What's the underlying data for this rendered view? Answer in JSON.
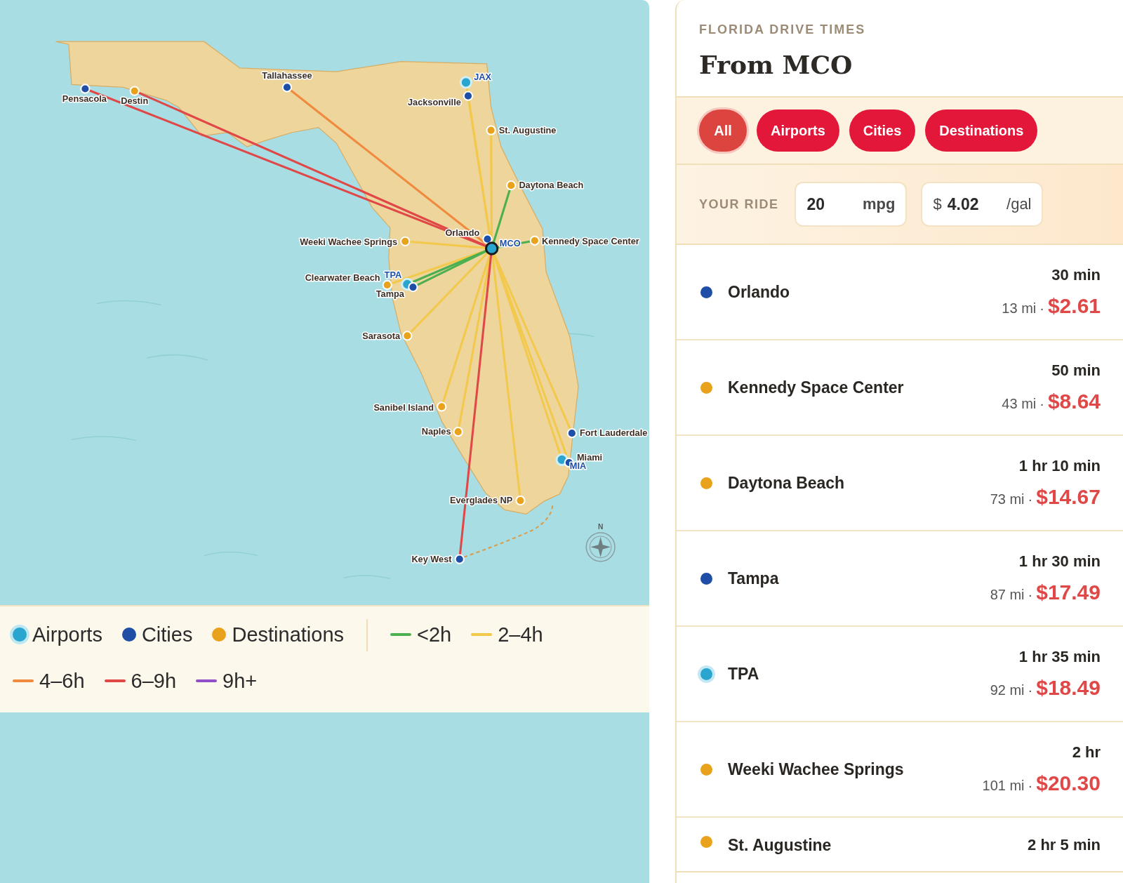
{
  "map": {
    "places": [
      {
        "label": "Pensacola",
        "kind": "city"
      },
      {
        "label": "Destin",
        "kind": "destination"
      },
      {
        "label": "Tallahassee",
        "kind": "city"
      },
      {
        "label": "JAX",
        "kind": "airport"
      },
      {
        "label": "Jacksonville",
        "kind": "city"
      },
      {
        "label": "St. Augustine",
        "kind": "destination"
      },
      {
        "label": "Daytona Beach",
        "kind": "destination"
      },
      {
        "label": "Orlando",
        "kind": "city"
      },
      {
        "label": "Weeki Wachee Springs",
        "kind": "destination"
      },
      {
        "label": "MCO",
        "kind": "origin"
      },
      {
        "label": "Kennedy Space Center",
        "kind": "destination"
      },
      {
        "label": "Clearwater Beach",
        "kind": "destination"
      },
      {
        "label": "TPA",
        "kind": "airport"
      },
      {
        "label": "Tampa",
        "kind": "city"
      },
      {
        "label": "Sarasota",
        "kind": "destination"
      },
      {
        "label": "Sanibel Island",
        "kind": "destination"
      },
      {
        "label": "Naples",
        "kind": "destination"
      },
      {
        "label": "Fort Lauderdale",
        "kind": "city"
      },
      {
        "label": "MIA",
        "kind": "airport"
      },
      {
        "label": "Miami",
        "kind": "city"
      },
      {
        "label": "Everglades NP",
        "kind": "destination"
      },
      {
        "label": "Key West",
        "kind": "city"
      }
    ],
    "compass": "N"
  },
  "legend": {
    "kinds": [
      {
        "label": "Airports",
        "kind": "airport",
        "color": "#2aa5cf"
      },
      {
        "label": "Cities",
        "kind": "city",
        "color": "#1f4ea6"
      },
      {
        "label": "Destinations",
        "kind": "destination",
        "color": "#e9a21c"
      }
    ],
    "bands": [
      {
        "label": "<2h",
        "color": "#4caf50"
      },
      {
        "label": "2–4h",
        "color": "#f2c94c"
      },
      {
        "label": "4–6h",
        "color": "#f08a3e"
      },
      {
        "label": "6–9h",
        "color": "#e04848"
      },
      {
        "label": "9h+",
        "color": "#9150c8"
      }
    ]
  },
  "panel": {
    "eyebrow": "FLORIDA DRIVE TIMES",
    "title": "From MCO",
    "filters": [
      {
        "label": "All",
        "selected": true
      },
      {
        "label": "Airports",
        "selected": false
      },
      {
        "label": "Cities",
        "selected": false
      },
      {
        "label": "Destinations",
        "selected": false
      }
    ],
    "ride": {
      "label": "YOUR RIDE",
      "mpg": {
        "value": "20",
        "unit": "mpg"
      },
      "price": {
        "prefix": "$",
        "value": "4.02",
        "unit": "/gal"
      }
    },
    "rows": [
      {
        "name": "Orlando",
        "kind": "city",
        "time": "30 min",
        "distance": "13 mi",
        "sep": "·",
        "cost": "$2.61"
      },
      {
        "name": "Kennedy Space Center",
        "kind": "destination",
        "time": "50 min",
        "distance": "43 mi",
        "sep": "·",
        "cost": "$8.64"
      },
      {
        "name": "Daytona Beach",
        "kind": "destination",
        "time": "1 hr 10 min",
        "distance": "73 mi",
        "sep": "·",
        "cost": "$14.67"
      },
      {
        "name": "Tampa",
        "kind": "city",
        "time": "1 hr 30 min",
        "distance": "87 mi",
        "sep": "·",
        "cost": "$17.49"
      },
      {
        "name": "TPA",
        "kind": "airport",
        "time": "1 hr 35 min",
        "distance": "92 mi",
        "sep": "·",
        "cost": "$18.49"
      },
      {
        "name": "Weeki Wachee Springs",
        "kind": "destination",
        "time": "2 hr",
        "distance": "101 mi",
        "sep": "·",
        "cost": "$20.30"
      },
      {
        "name": "St. Augustine",
        "kind": "destination",
        "time": "2 hr 5 min"
      }
    ]
  }
}
